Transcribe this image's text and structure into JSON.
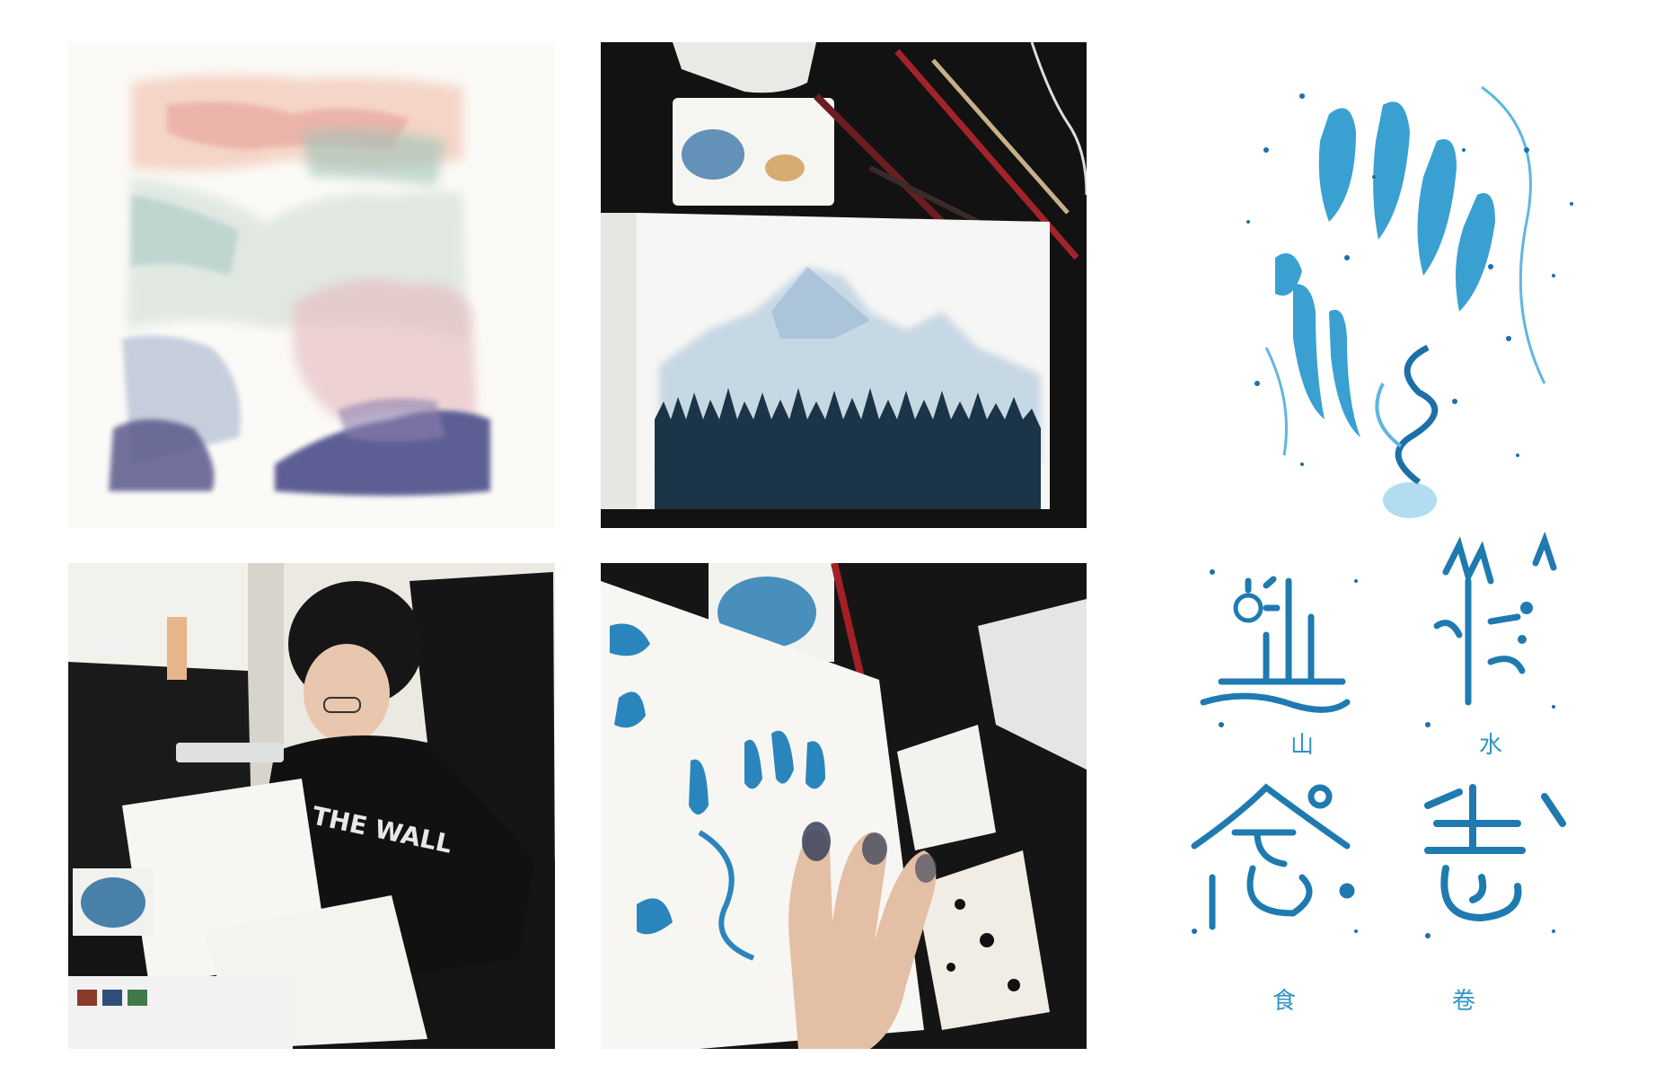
{
  "gallery": {
    "photos": [
      {
        "subject": "watercolor landscape"
      },
      {
        "subject": "mountain painting on desk"
      },
      {
        "subject": "artist painting at desk"
      },
      {
        "subject": "ink calligraphy with inked fingers"
      }
    ]
  },
  "artwork": {
    "glyphs": [
      {
        "char": "山",
        "caption": "山"
      },
      {
        "char": "水",
        "caption": "水"
      },
      {
        "char": "念",
        "caption": "食"
      },
      {
        "char": "卷",
        "caption": "卷"
      }
    ]
  },
  "colors": {
    "ink_blue": "#1d7fb4",
    "ink_light": "#5fb7de",
    "ink_navy": "#1b3f66",
    "paper": "#fdfcfa"
  }
}
